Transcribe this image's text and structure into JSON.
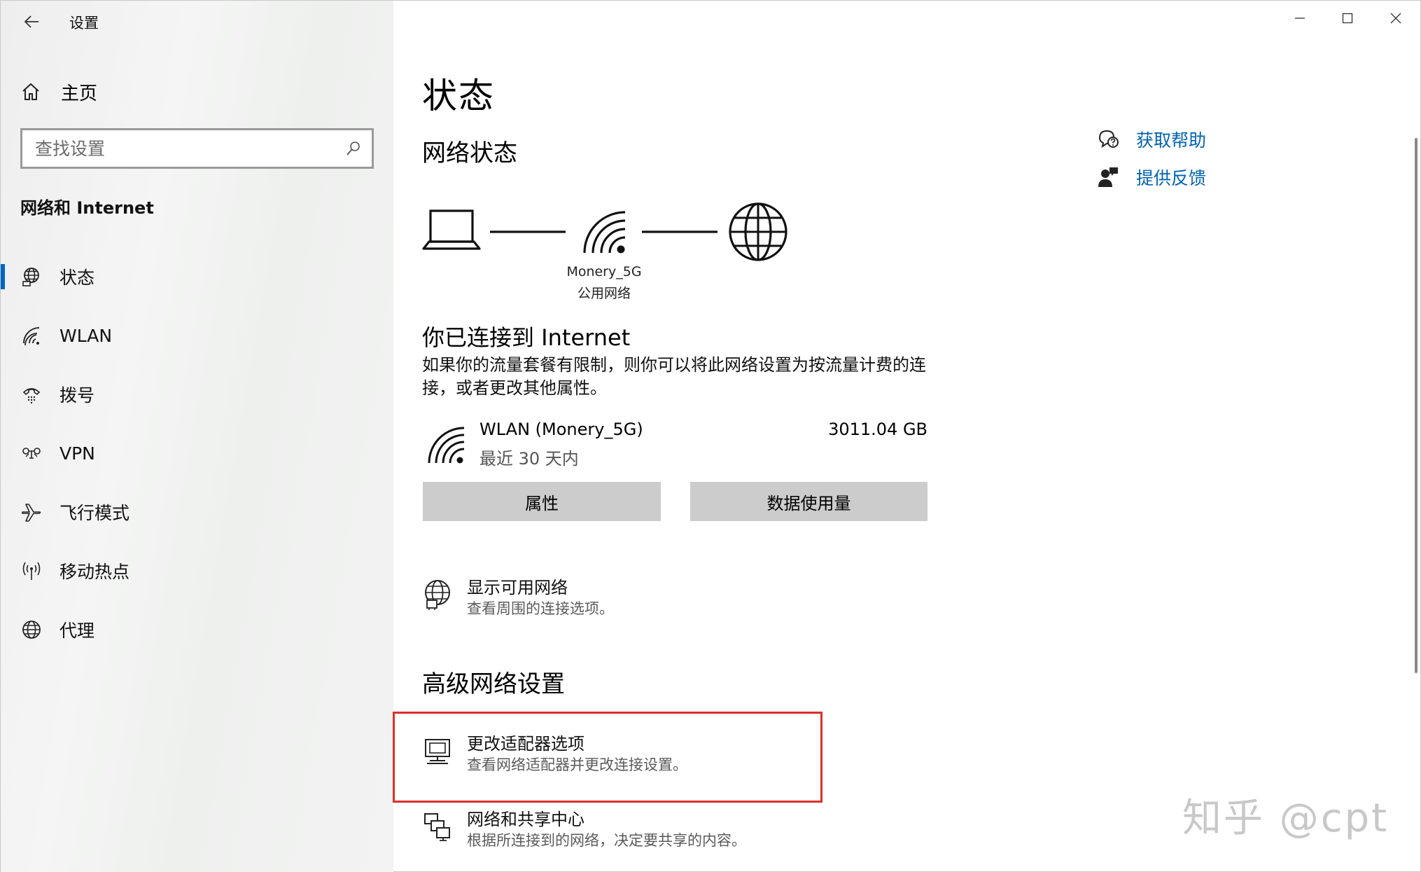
{
  "window": {
    "app_title": "设置",
    "controls": [
      "minimize-icon",
      "maximize-icon",
      "close-icon"
    ]
  },
  "sidebar": {
    "home_label": "主页",
    "search": {
      "placeholder": "查找设置",
      "value": ""
    },
    "section_title": "网络和 Internet",
    "items": [
      {
        "label": "状态",
        "icon": "status-globe-icon",
        "active": true
      },
      {
        "label": "WLAN",
        "icon": "wifi-icon",
        "active": false
      },
      {
        "label": "拨号",
        "icon": "dialup-icon",
        "active": false
      },
      {
        "label": "VPN",
        "icon": "vpn-icon",
        "active": false
      },
      {
        "label": "飞行模式",
        "icon": "airplane-icon",
        "active": false
      },
      {
        "label": "移动热点",
        "icon": "hotspot-icon",
        "active": false
      },
      {
        "label": "代理",
        "icon": "globe-icon",
        "active": false
      }
    ]
  },
  "main": {
    "page_title": "状态",
    "network_status_heading": "网络状态",
    "diagram": {
      "network_name": "Monery_5G",
      "network_type": "公用网络"
    },
    "connected_title": "你已连接到 Internet",
    "connected_desc": "如果你的流量套餐有限制，则你可以将此网络设置为按流量计费的连接，或者更改其他属性。",
    "connection": {
      "name": "WLAN (Monery_5G)",
      "period": "最近 30 天内",
      "usage": "3011.04 GB"
    },
    "buttons": {
      "properties": "属性",
      "data_usage": "数据使用量"
    },
    "show_networks": {
      "title": "显示可用网络",
      "desc": "查看周围的连接选项。"
    },
    "advanced_heading": "高级网络设置",
    "adapter_options": {
      "title": "更改适配器选项",
      "desc": "查看网络适配器并更改连接设置。"
    },
    "sharing_center": {
      "title": "网络和共享中心",
      "desc": "根据所连接到的网络，决定要共享的内容。"
    }
  },
  "help": {
    "get_help": "获取帮助",
    "feedback": "提供反馈"
  },
  "watermark": "知乎 @cpt",
  "colors": {
    "accent": "#0067c0",
    "link": "#0063b1",
    "highlight_border": "#d9312b",
    "button_bg": "#cccccc"
  }
}
